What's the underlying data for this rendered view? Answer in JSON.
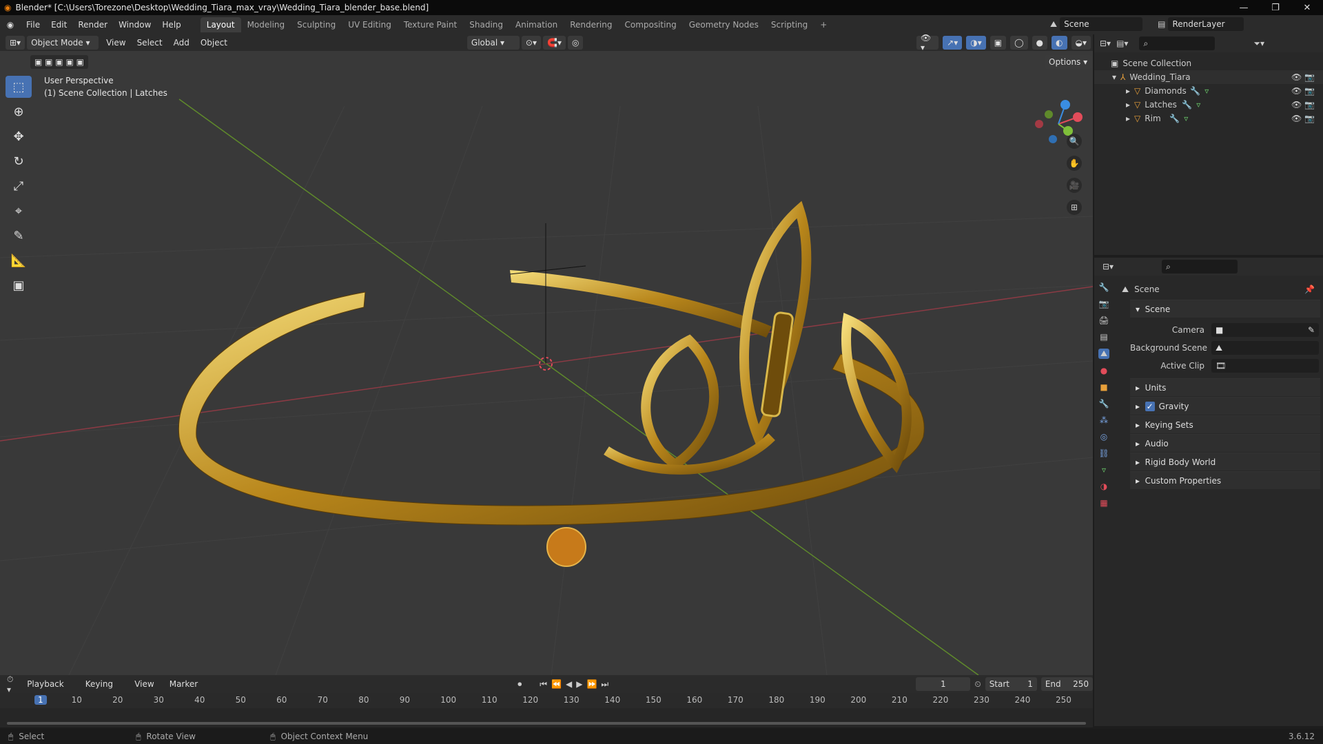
{
  "window": {
    "title": "Blender* [C:\\Users\\Torezone\\Desktop\\Wedding_Tiara_max_vray\\Wedding_Tiara_blender_base.blend]"
  },
  "menus": [
    "File",
    "Edit",
    "Render",
    "Window",
    "Help"
  ],
  "workspaces": [
    "Layout",
    "Modeling",
    "Sculpting",
    "UV Editing",
    "Texture Paint",
    "Shading",
    "Animation",
    "Rendering",
    "Compositing",
    "Geometry Nodes",
    "Scripting"
  ],
  "scene_name": "Scene",
  "render_layer": "RenderLayer",
  "header3d": {
    "mode": "Object Mode",
    "view": "View",
    "select": "Select",
    "add": "Add",
    "object": "Object",
    "orientation": "Global",
    "options": "Options"
  },
  "viewport": {
    "perspective": "User Perspective",
    "context": "(1) Scene Collection | Latches"
  },
  "outliner": {
    "root": "Scene Collection",
    "collection": "Wedding_Tiara",
    "items": [
      {
        "label": "Diamonds"
      },
      {
        "label": "Latches"
      },
      {
        "label": "Rim"
      }
    ]
  },
  "properties": {
    "header": "Scene",
    "section_scene": "Scene",
    "camera_label": "Camera",
    "bg_scene_label": "Background Scene",
    "active_clip_label": "Active Clip",
    "sections": [
      "Units",
      "Gravity",
      "Keying Sets",
      "Audio",
      "Rigid Body World",
      "Custom Properties"
    ],
    "gravity_checked": true
  },
  "timeline": {
    "playback": "Playback",
    "keying": "Keying",
    "view": "View",
    "marker": "Marker",
    "current_frame": "1",
    "start_label": "Start",
    "start": "1",
    "end_label": "End",
    "end": "250",
    "ticks": [
      "1",
      "10",
      "20",
      "30",
      "40",
      "50",
      "60",
      "70",
      "80",
      "90",
      "100",
      "110",
      "120",
      "130",
      "140",
      "150",
      "160",
      "170",
      "180",
      "190",
      "200",
      "210",
      "220",
      "230",
      "240",
      "250"
    ]
  },
  "status": {
    "select": "Select",
    "rotate": "Rotate View",
    "context_menu": "Object Context Menu",
    "version": "3.6.12"
  },
  "colors": {
    "accent": "#4772b3",
    "gold": "#c9a227",
    "x_axis": "#e24c5a",
    "y_axis": "#7fbf3a",
    "z_axis": "#3a8de2"
  }
}
